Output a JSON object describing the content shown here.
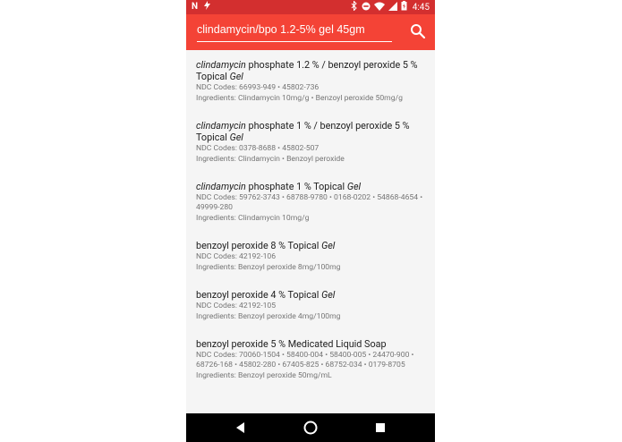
{
  "statusbar": {
    "time": "4:45",
    "icons": [
      "n-icon",
      "lightning-icon",
      "bluetooth-icon",
      "do-not-disturb-icon",
      "wifi-icon",
      "signal-icon",
      "battery-icon"
    ]
  },
  "search": {
    "query": "clindamycin/bpo 1.2-5% gel 45gm"
  },
  "results": [
    {
      "title_parts": [
        {
          "text": "clindamycin",
          "italic": true
        },
        {
          "text": " phosphate 1.2 % / benzoyl peroxide 5 % Topical ",
          "italic": false
        },
        {
          "text": "Gel",
          "italic": true
        }
      ],
      "ndc": "NDC Codes: 66993-949 • 45802-736",
      "ingredients": "Ingredients: Clindamycin 10mg/g • Benzoyl peroxide 50mg/g"
    },
    {
      "title_parts": [
        {
          "text": "clindamycin",
          "italic": true
        },
        {
          "text": " phosphate 1 % / benzoyl peroxide 5 % Topical ",
          "italic": false
        },
        {
          "text": "Gel",
          "italic": true
        }
      ],
      "ndc": "NDC Codes: 0378-8688 • 45802-507",
      "ingredients": "Ingredients: Clindamycin  • Benzoyl peroxide"
    },
    {
      "title_parts": [
        {
          "text": "clindamycin",
          "italic": true
        },
        {
          "text": " phosphate 1 % Topical ",
          "italic": false
        },
        {
          "text": "Gel",
          "italic": true
        }
      ],
      "ndc": "NDC Codes: 59762-3743 • 68788-9780 • 0168-0202 • 54868-4654 • 49999-280",
      "ingredients": "Ingredients: Clindamycin 10mg/g"
    },
    {
      "title_parts": [
        {
          "text": "benzoyl peroxide 8 % Topical ",
          "italic": false
        },
        {
          "text": "Gel",
          "italic": true
        }
      ],
      "ndc": "NDC Codes: 42192-106",
      "ingredients": "Ingredients: Benzoyl peroxide 8mg/100mg"
    },
    {
      "title_parts": [
        {
          "text": "benzoyl peroxide 4 % Topical ",
          "italic": false
        },
        {
          "text": "Gel",
          "italic": true
        }
      ],
      "ndc": "NDC Codes: 42192-105",
      "ingredients": "Ingredients: Benzoyl peroxide 4mg/100mg"
    },
    {
      "title_parts": [
        {
          "text": "benzoyl peroxide 5 % Medicated Liquid Soap",
          "italic": false
        }
      ],
      "ndc": "NDC Codes: 70060-1504 • 58400-004 • 58400-005 • 24470-900 • 68726-168 • 45802-280 • 67405-825 • 68752-034 • 0179-8705",
      "ingredients": "Ingredients: Benzoyl peroxide 50mg/mL"
    }
  ],
  "navbar": {
    "buttons": [
      "back-icon",
      "home-icon",
      "recents-icon"
    ]
  },
  "colors": {
    "toolbar": "#f44336",
    "statusbar": "#d32f2f",
    "list_bg": "#f5f5f5"
  }
}
